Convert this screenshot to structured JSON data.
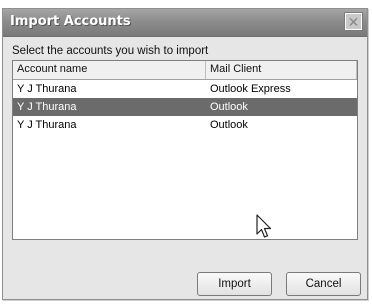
{
  "window": {
    "title": "Import Accounts",
    "close_symbol": "✕"
  },
  "instruction": "Select the accounts you wish to import",
  "list": {
    "columns": [
      "Account name",
      "Mail Client"
    ],
    "rows": [
      {
        "account": "Y J Thurana",
        "client": "Outlook Express",
        "selected": false
      },
      {
        "account": "Y J Thurana",
        "client": "Outlook",
        "selected": true
      },
      {
        "account": "Y J Thurana",
        "client": "Outlook",
        "selected": false
      }
    ]
  },
  "buttons": {
    "import": "Import",
    "cancel": "Cancel"
  },
  "colors": {
    "selection": "#6b6b6b",
    "titlebar": "#8c8c8c"
  },
  "icons": [
    "close-icon",
    "mouse-pointer-icon"
  ]
}
